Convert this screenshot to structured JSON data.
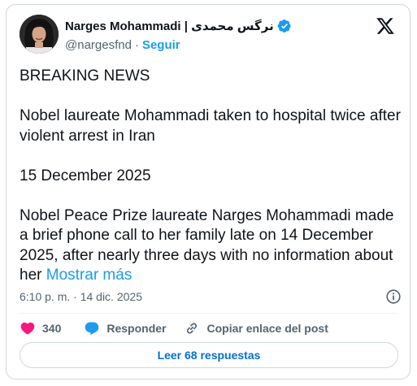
{
  "author": {
    "display_name": "Narges Mohammadi | نرگس محمدی",
    "handle": "@nargesfnd",
    "separator": "·",
    "follow_label": "Seguir",
    "avatar_icon": "profile-photo",
    "verified_icon": "verified-badge-icon",
    "verified_color": "#1d9bf0"
  },
  "platform": {
    "logo_icon": "x-logo-icon"
  },
  "tweet": {
    "line1": "BREAKING NEWS",
    "line2": "Nobel laureate Mohammadi taken to hospital twice after violent arrest in Iran",
    "line3": "15 December 2025",
    "line4": "Nobel Peace Prize laureate Narges Mohammadi made a brief phone call to her family late on 14 December 2025, after nearly three days with no information about her",
    "show_more": "Mostrar más",
    "link_color": "#1d9bf0"
  },
  "meta": {
    "timestamp": "6:10 p. m. · 14 dic. 2025",
    "info_icon": "info-icon"
  },
  "actions": {
    "like_count": "340",
    "like_color": "#f91880",
    "reply_label": "Responder",
    "reply_color": "#1d9bf0",
    "copy_label": "Copiar enlace del post"
  },
  "replies_button": {
    "label": "Leer 68 respuestas"
  }
}
